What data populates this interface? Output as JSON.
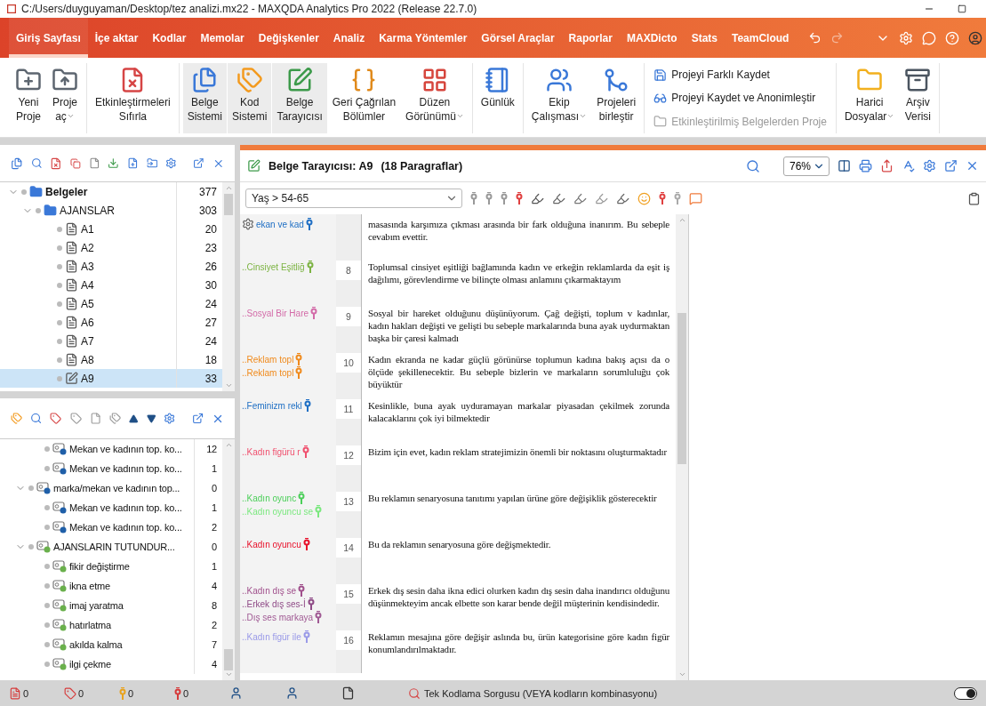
{
  "window": {
    "title": "C:/Users/duyguyaman/Desktop/tez analizi.mx22 - MAXQDA Analytics Pro 2022 (Release 22.7.0)"
  },
  "menu": {
    "tabs": [
      {
        "label": "Giriş Sayfası",
        "selected": true
      },
      {
        "label": "İçe aktar",
        "selected": false
      },
      {
        "label": "Kodlar",
        "selected": false
      },
      {
        "label": "Memolar",
        "selected": false
      },
      {
        "label": "Değişkenler",
        "selected": false
      },
      {
        "label": "Analiz",
        "selected": false
      },
      {
        "label": "Karma Yöntemler",
        "selected": false
      },
      {
        "label": "Görsel Araçlar",
        "selected": false
      },
      {
        "label": "Raporlar",
        "selected": false
      },
      {
        "label": "MAXDicto",
        "selected": false
      },
      {
        "label": "Stats",
        "selected": false
      },
      {
        "label": "TeamCloud",
        "selected": false
      }
    ]
  },
  "ribbon": {
    "groups": [
      {
        "kind": "buttons",
        "items": [
          {
            "lines": [
              "Yeni",
              "Proje"
            ],
            "selected": false,
            "dropdown": false
          },
          {
            "lines": [
              "Proje",
              "aç"
            ],
            "selected": false,
            "dropdown": true
          }
        ]
      },
      {
        "kind": "buttons",
        "items": [
          {
            "lines": [
              "Etkinleştirmeleri",
              "Sıfırla"
            ],
            "selected": false,
            "dropdown": false
          }
        ]
      },
      {
        "kind": "buttons",
        "items": [
          {
            "lines": [
              "Belge",
              "Sistemi"
            ],
            "selected": true,
            "dropdown": false
          },
          {
            "lines": [
              "Kod",
              "Sistemi"
            ],
            "selected": true,
            "dropdown": false
          },
          {
            "lines": [
              "Belge",
              "Tarayıcısı"
            ],
            "selected": true,
            "dropdown": false
          },
          {
            "lines": [
              "Geri Çağrılan",
              "Bölümler"
            ],
            "selected": false,
            "dropdown": false
          },
          {
            "lines": [
              "Düzen",
              "Görünümü"
            ],
            "selected": false,
            "dropdown": true
          }
        ]
      },
      {
        "kind": "buttons",
        "items": [
          {
            "lines": [
              "Günlük"
            ],
            "selected": false,
            "dropdown": false
          }
        ]
      },
      {
        "kind": "buttons",
        "items": [
          {
            "lines": [
              "Ekip",
              "Çalışması"
            ],
            "selected": false,
            "dropdown": true
          },
          {
            "lines": [
              "Projeleri",
              "birleştir"
            ],
            "selected": false,
            "dropdown": false
          }
        ]
      },
      {
        "kind": "stack",
        "items": [
          {
            "label": "Projeyi Farklı Kaydet",
            "disabled": false
          },
          {
            "label": "Projeyi Kaydet ve Anonimleştir",
            "disabled": false
          },
          {
            "label": "Etkinleştirilmiş Belgelerden Proje",
            "disabled": true
          }
        ]
      },
      {
        "kind": "buttons",
        "items": [
          {
            "lines": [
              "Harici",
              "Dosyalar"
            ],
            "selected": false,
            "dropdown": true
          },
          {
            "lines": [
              "Arşiv",
              "Verisi"
            ],
            "selected": false,
            "dropdown": false
          }
        ]
      }
    ]
  },
  "document_system": {
    "items": [
      {
        "label": "Belgeler",
        "count": "377",
        "kind": "root",
        "expanded": true,
        "selected": false,
        "children": [
          {
            "label": "AJANSLAR",
            "count": "303",
            "kind": "folder",
            "expanded": true,
            "selected": false,
            "children": [
              {
                "label": "A1",
                "count": "20",
                "kind": "document",
                "selected": false
              },
              {
                "label": "A2",
                "count": "23",
                "kind": "document",
                "selected": false
              },
              {
                "label": "A3",
                "count": "26",
                "kind": "document",
                "selected": false
              },
              {
                "label": "A4",
                "count": "30",
                "kind": "document",
                "selected": false
              },
              {
                "label": "A5",
                "count": "24",
                "kind": "document",
                "selected": false
              },
              {
                "label": "A6",
                "count": "27",
                "kind": "document",
                "selected": false
              },
              {
                "label": "A7",
                "count": "24",
                "kind": "document",
                "selected": false
              },
              {
                "label": "A8",
                "count": "18",
                "kind": "document",
                "selected": false
              },
              {
                "label": "A9",
                "count": "33",
                "kind": "edited",
                "selected": true
              }
            ]
          }
        ]
      }
    ]
  },
  "code_system": {
    "continued_children": [
      {
        "label": "Mekan ve kadının top. ko...",
        "count": "12",
        "color": "#1f5fa8"
      },
      {
        "label": "Mekan ve kadının top. ko...",
        "count": "1",
        "color": "#1f5fa8"
      }
    ],
    "items": [
      {
        "label": "marka/mekan ve kadının top...",
        "count": "0",
        "color": "#1f5fa8",
        "expanded": true,
        "children": [
          {
            "label": "Mekan ve kadının top. ko...",
            "count": "1",
            "color": "#1f5fa8"
          },
          {
            "label": "Mekan ve kadının top. ko...",
            "count": "2",
            "color": "#1f5fa8"
          }
        ]
      },
      {
        "label": "AJANSLARIN TUTUNDUR...",
        "count": "0",
        "color": "#6ab04c",
        "expanded": true,
        "children": [
          {
            "label": "fikir değiştirme",
            "count": "1",
            "color": "#6ab04c"
          },
          {
            "label": "ikna etme",
            "count": "4",
            "color": "#6ab04c"
          },
          {
            "label": "imaj yaratma",
            "count": "8",
            "color": "#6ab04c"
          },
          {
            "label": "hatırlatma",
            "count": "2",
            "color": "#6ab04c"
          },
          {
            "label": "akılda kalma",
            "count": "7",
            "color": "#6ab04c"
          },
          {
            "label": "ilgi çekme",
            "count": "4",
            "color": "#6ab04c"
          }
        ]
      }
    ]
  },
  "document_browser": {
    "title": "Belge Tarayıcısı: A9",
    "paragraph_count": "(18 Paragraflar)",
    "zoom": "76%",
    "filter": "Yaş > 54-65",
    "paragraphs": [
      {
        "text": "masasında karşımıza çıkması arasında bir fark olduğuna inanırım. Bu sebeple cevabım evettir.",
        "codes": [
          {
            "label": "ekan ve kad",
            "color": "#1f6fc4"
          }
        ]
      },
      {
        "number": "8",
        "text": "Toplumsal cinsiyet eşitliği bağlamında kadın ve erkeğin reklamlarda da eşit iş dağılımı, görevlendirme ve bilinçte olması anlamını çıkarmaktayım",
        "codes": [
          {
            "label": "..Cinsiyet Eşitliğ",
            "color": "#7cb342"
          }
        ]
      },
      {
        "number": "9",
        "text": "Sosyal bir hareket olduğunu düşünüyorum. Çağ değişti, toplum v kadınlar, kadın hakları değişti ve gelişti bu sebeple markalarında buna ayak uydurmaktan başka bir çaresi kalmadı",
        "codes": [
          {
            "label": "..Sosyal Bir Hare",
            "color": "#d36ba8"
          }
        ]
      },
      {
        "number": "10",
        "text": "Kadın ekranda ne kadar güçlü görünürse toplumun kadına bakış açısı da o ölçüde şekillenecektir. Bu sebeple bizlerin ve markaların sorumluluğu çok büyüktür",
        "codes": [
          {
            "label": "..Reklam topl",
            "color": "#f08a1c"
          },
          {
            "label": "..Reklam topl",
            "color": "#f08a1c"
          }
        ]
      },
      {
        "number": "11",
        "text": "Kesinlikle, buna ayak uyduramayan markalar piyasadan çekilmek zorunda kalacaklarını çok iyi bilmektedir",
        "codes": [
          {
            "label": "..Feminizm rekl",
            "color": "#1f6fc4"
          }
        ]
      },
      {
        "number": "12",
        "text": "Bizim için evet, kadın reklam stratejimizin önemli bir noktasını oluşturmaktadır",
        "codes": [
          {
            "label": "..Kadın figürü r",
            "color": "#f0506e"
          }
        ]
      },
      {
        "number": "13",
        "text": "Bu reklamın senaryosuna tanıtımı yapılan ürüne göre değişiklik gösterecektir",
        "codes": [
          {
            "label": "..Kadın oyunc",
            "color": "#4ccf5a"
          },
          {
            "label": "..Kadın oyuncu se",
            "color": "#7be87f"
          }
        ]
      },
      {
        "number": "14",
        "text": "Bu da reklamın senaryosuna göre değişmektedir.",
        "codes": [
          {
            "label": "..Kadın oyuncu",
            "color": "#e8102a"
          }
        ]
      },
      {
        "number": "15",
        "text": "Erkek dış sesin daha ikna edici olurken kadın dış sesin daha inandırıcı olduğunu düşünmekteyim ancak elbette son karar bende değil müşterinin kendisindedir.",
        "codes": [
          {
            "label": "..Kadın dış se",
            "color": "#a0508c"
          },
          {
            "label": "..Erkek dış ses-İ",
            "color": "#8e4a86"
          },
          {
            "label": "..Dış ses markaya",
            "color": "#a05a94"
          }
        ]
      },
      {
        "number": "16",
        "text": "Reklamın mesajına göre değişir aslında bu, ürün kategorisine göre kadın figür konumlandırılmaktadır.",
        "codes": [
          {
            "label": "..Kadın figür ile",
            "color": "#9a9ae8"
          }
        ]
      }
    ]
  },
  "status_bar": {
    "counters": [
      {
        "kind": "documents",
        "value": "0"
      },
      {
        "kind": "codes",
        "value": "0"
      },
      {
        "kind": "segments",
        "value": "0"
      },
      {
        "kind": "weights",
        "value": "0"
      }
    ],
    "query": "Tek Kodlama Sorgusu (VEYA kodların kombinasyonu)",
    "toggle": {
      "on": true
    }
  }
}
